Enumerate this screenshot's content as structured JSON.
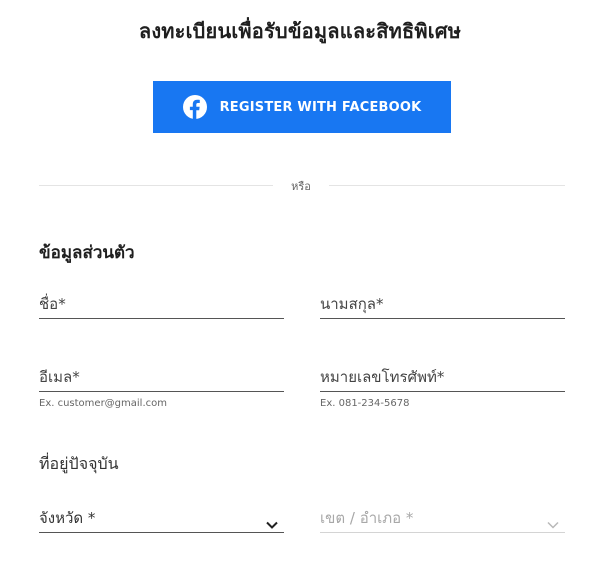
{
  "header": {
    "title": "ลงทะเบียนเพื่อรับข้อมูลและสิทธิพิเศษ"
  },
  "facebook": {
    "label": "REGISTER WITH FACEBOOK",
    "icon": "facebook-icon",
    "color": "#1877f2"
  },
  "divider": {
    "text": "หรือ"
  },
  "personal_info": {
    "heading": "ข้อมูลส่วนตัว",
    "first_name": {
      "placeholder": "ชื่อ*",
      "value": ""
    },
    "last_name": {
      "placeholder": "นามสกุล*",
      "value": ""
    },
    "email": {
      "placeholder": "อีเมล*",
      "value": "",
      "hint": "Ex. customer@gmail.com"
    },
    "phone": {
      "placeholder": "หมายเลขโทรศัพท์*",
      "value": "",
      "hint": "Ex. 081-234-5678"
    }
  },
  "address": {
    "heading": "ที่อยู่ปัจจุบัน",
    "province": {
      "label": "จังหวัด *",
      "icon": "chevron-down-icon",
      "enabled": true
    },
    "district": {
      "label": "เขต / อำเภอ *",
      "icon": "chevron-down-icon",
      "enabled": false
    }
  }
}
